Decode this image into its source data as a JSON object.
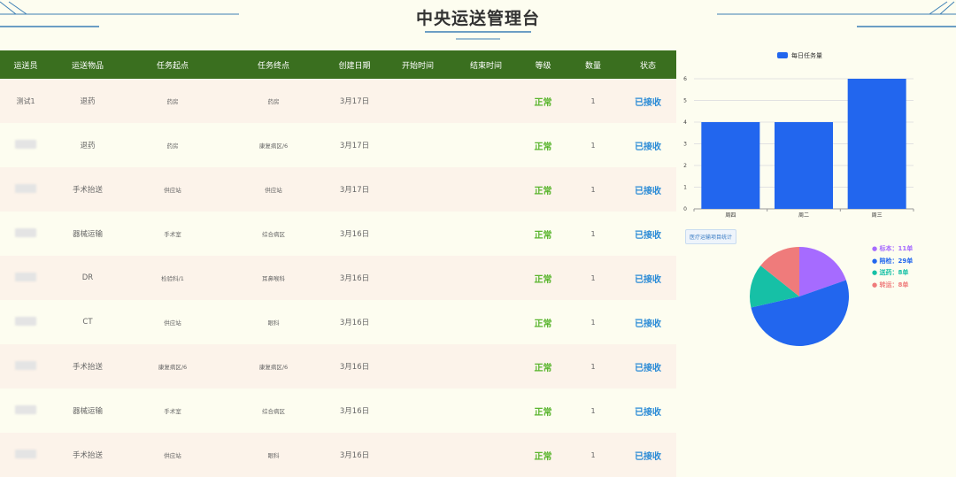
{
  "title": "中央运送管理台",
  "table": {
    "headers": [
      "运送员",
      "运送物品",
      "任务起点",
      "任务终点",
      "创建日期",
      "开始时间",
      "结束时间",
      "等级",
      "数量",
      "状态"
    ],
    "rows": [
      {
        "courier": "测试1",
        "courier_hidden": false,
        "item": "退药",
        "from": "药房",
        "to": "药房",
        "date": "3月17日",
        "start": "",
        "end": "",
        "level": "正常",
        "qty": "1",
        "status": "已接收"
      },
      {
        "courier": "",
        "courier_hidden": true,
        "item": "退药",
        "from": "药房",
        "to": "康复病区/6",
        "date": "3月17日",
        "start": "",
        "end": "",
        "level": "正常",
        "qty": "1",
        "status": "已接收"
      },
      {
        "courier": "",
        "courier_hidden": true,
        "item": "手术抬送",
        "from": "供应站",
        "to": "供应站",
        "date": "3月17日",
        "start": "",
        "end": "",
        "level": "正常",
        "qty": "1",
        "status": "已接收"
      },
      {
        "courier": "",
        "courier_hidden": true,
        "item": "器械运输",
        "from": "手术室",
        "to": "综合病区",
        "date": "3月16日",
        "start": "",
        "end": "",
        "level": "正常",
        "qty": "1",
        "status": "已接收"
      },
      {
        "courier": "",
        "courier_hidden": true,
        "item": "DR",
        "from": "检验科/1",
        "to": "耳鼻喉科",
        "date": "3月16日",
        "start": "",
        "end": "",
        "level": "正常",
        "qty": "1",
        "status": "已接收"
      },
      {
        "courier": "",
        "courier_hidden": true,
        "item": "CT",
        "from": "供应站",
        "to": "眼科",
        "date": "3月16日",
        "start": "",
        "end": "",
        "level": "正常",
        "qty": "1",
        "status": "已接收"
      },
      {
        "courier": "",
        "courier_hidden": true,
        "item": "手术抬送",
        "from": "康复病区/6",
        "to": "康复病区/6",
        "date": "3月16日",
        "start": "",
        "end": "",
        "level": "正常",
        "qty": "1",
        "status": "已接收"
      },
      {
        "courier": "",
        "courier_hidden": true,
        "item": "器械运输",
        "from": "手术室",
        "to": "综合病区",
        "date": "3月16日",
        "start": "",
        "end": "",
        "level": "正常",
        "qty": "1",
        "status": "已接收"
      },
      {
        "courier": "",
        "courier_hidden": true,
        "item": "手术抬送",
        "from": "供应站",
        "to": "眼科",
        "date": "3月16日",
        "start": "",
        "end": "",
        "level": "正常",
        "qty": "1",
        "status": "已接收"
      }
    ]
  },
  "colors": {
    "header_bg": "#3a6f1f",
    "level": "#5ab52e",
    "status": "#2b8bd6",
    "bar": "#2266ee"
  },
  "chart_data": [
    {
      "type": "bar",
      "legend": [
        "每日任务量"
      ],
      "legend_position": "top",
      "categories": [
        "周四",
        "周二",
        "周三"
      ],
      "values": [
        4,
        4,
        6
      ],
      "ylim": [
        0,
        6
      ],
      "yticks": [
        0,
        1,
        2,
        3,
        4,
        5,
        6
      ],
      "grid": true,
      "title": "",
      "xlabel": "",
      "ylabel": ""
    },
    {
      "type": "pie",
      "title_button": "医疗运输项目统计",
      "legend_position": "right",
      "slices": [
        {
          "name": "标本",
          "value": 11,
          "unit": "单",
          "color": "#a66bff"
        },
        {
          "name": "陪检",
          "value": 29,
          "unit": "单",
          "color": "#2266ee"
        },
        {
          "name": "送药",
          "value": 8,
          "unit": "单",
          "color": "#16c0a6"
        },
        {
          "name": "转运",
          "value": 8,
          "unit": "单",
          "color": "#ef7b7b"
        }
      ]
    }
  ]
}
